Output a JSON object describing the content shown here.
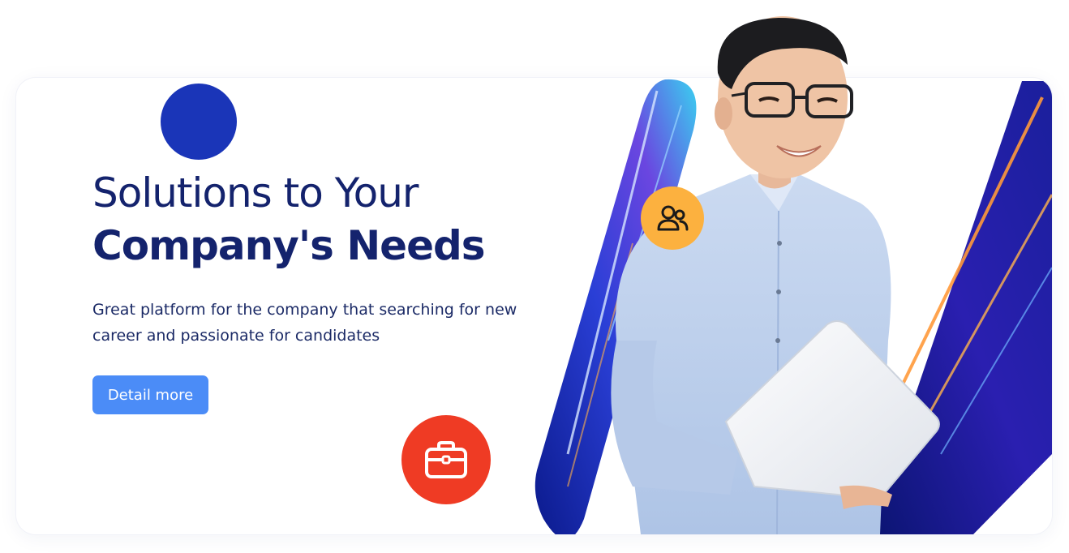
{
  "hero": {
    "title_line1": "Solutions to Your",
    "title_line2": "Company's Needs",
    "description": "Great platform for the company that searching for new career and passionate for candidates",
    "cta_label": "Detail more"
  },
  "icons": {
    "team": "users-icon",
    "briefcase": "briefcase-icon"
  },
  "colors": {
    "title": "#14236d",
    "accent_blue": "#1a35b8",
    "button": "#4b8cf7",
    "badge_red": "#ef3b24",
    "badge_orange": "#fcb13f"
  }
}
